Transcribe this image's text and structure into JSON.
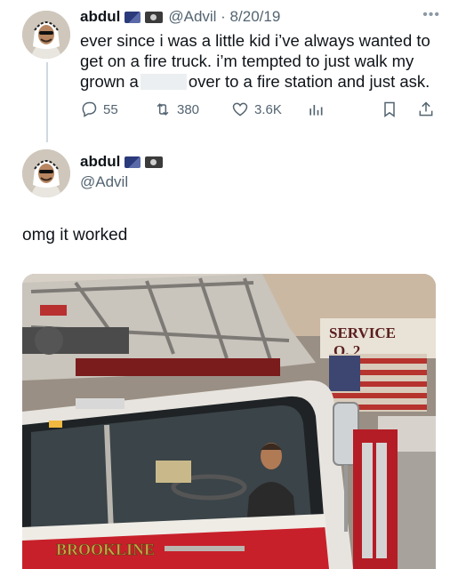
{
  "tweet1": {
    "author_name": "abdul",
    "handle_date": "@Advil · 8/20/19",
    "more_icon": "ellipsis-icon",
    "text_before_redaction": "ever since i was a little kid i’ve always wanted to get on a fire truck. i’m tempted to just walk my grown a",
    "text_after_redaction": "over to a fire station and just ask.",
    "actions": {
      "replies": "55",
      "retweets": "380",
      "likes": "3.6K"
    }
  },
  "tweet2": {
    "author_name": "abdul",
    "handle": "@Advil",
    "text": "omg it worked"
  },
  "photo": {
    "sign_text": "SERVICE",
    "sign_number": "O. 2",
    "truck_lettering": "BROOKLINE"
  },
  "colors": {
    "text_primary": "#0f1419",
    "text_secondary": "#536471",
    "thread_line": "#cfd9de",
    "truck_red": "#c8202a"
  }
}
